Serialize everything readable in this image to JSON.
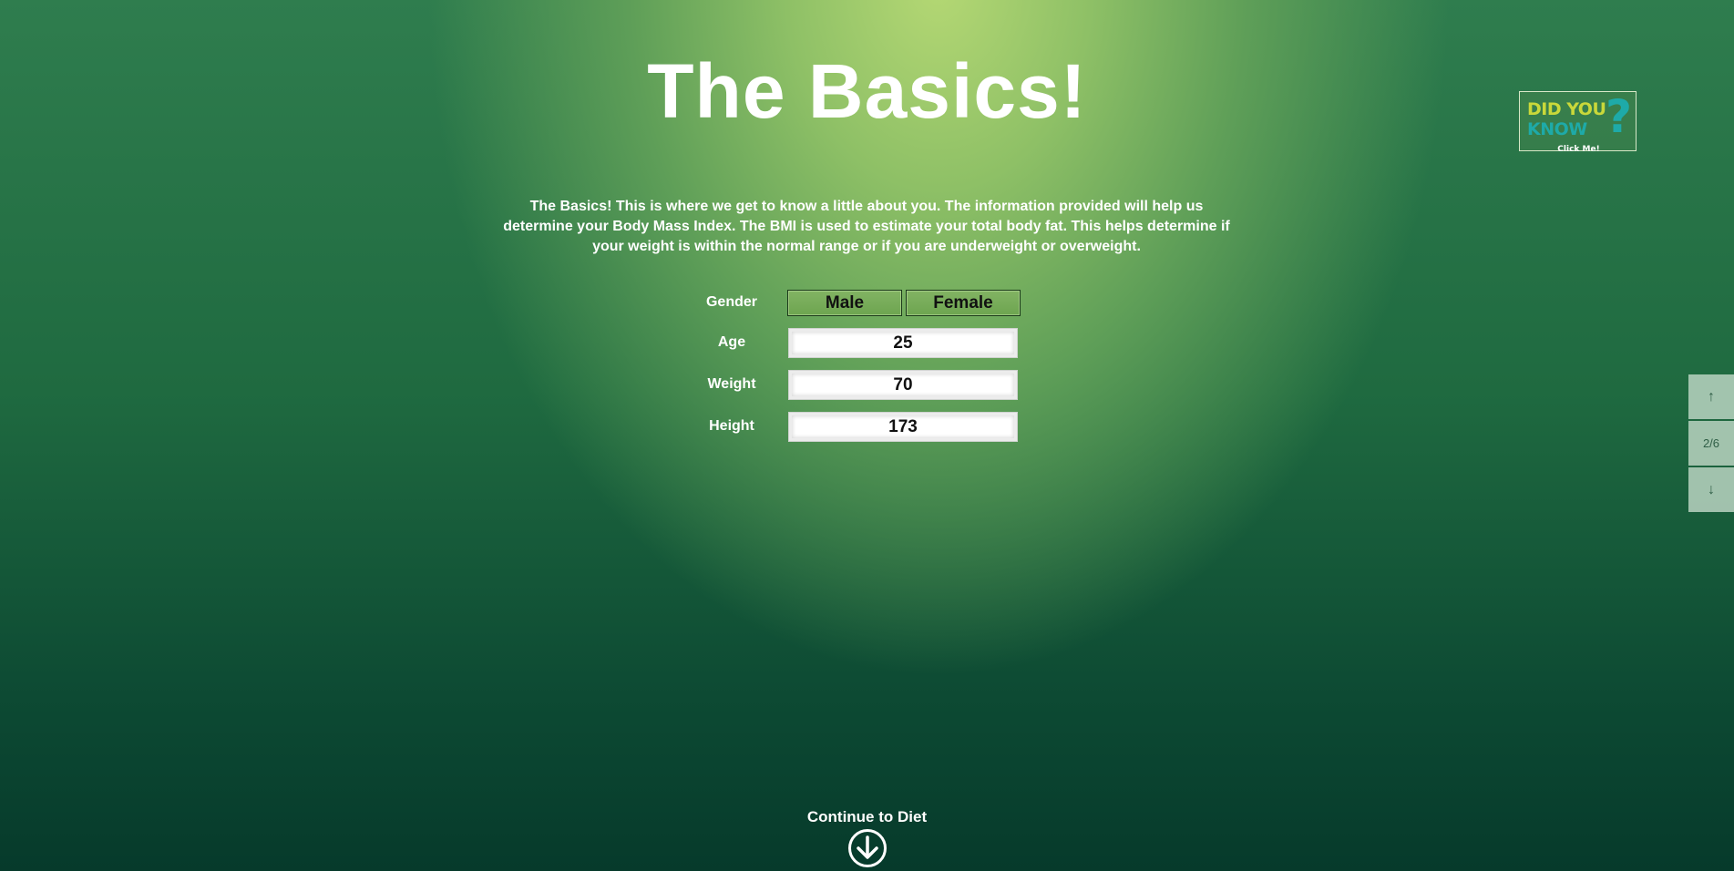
{
  "page": {
    "title": "The Basics!",
    "intro": "The Basics! This is where we get to know a little about you. The information provided will help us determine your Body Mass Index. The BMI is used to estimate your total body fat. This helps determine if your weight is within the normal range or if you are underweight or overweight."
  },
  "form": {
    "gender_label": "Gender",
    "gender_options": [
      "Male",
      "Female"
    ],
    "age_label": "Age",
    "age_value": "25",
    "weight_label": "Weight",
    "weight_value": "70",
    "height_label": "Height",
    "height_value": "173"
  },
  "logo": {
    "line1": "DID YOU",
    "line2": "KNOW",
    "qmark": "?",
    "click": "Click Me!"
  },
  "side_nav": {
    "up_icon": "arrow-up-icon",
    "up_glyph": "↑",
    "page_indicator": "2/6",
    "down_icon": "arrow-down-icon",
    "down_glyph": "↓"
  },
  "footer": {
    "continue_label": "Continue to Diet",
    "continue_icon": "circle-arrow-down-icon"
  },
  "colors": {
    "bg_light": "#b5d874",
    "bg_dark": "#063a2b",
    "button_fill": "#77ab58",
    "logo_yellow": "#c9d83a",
    "logo_teal": "#1eaaa8"
  }
}
